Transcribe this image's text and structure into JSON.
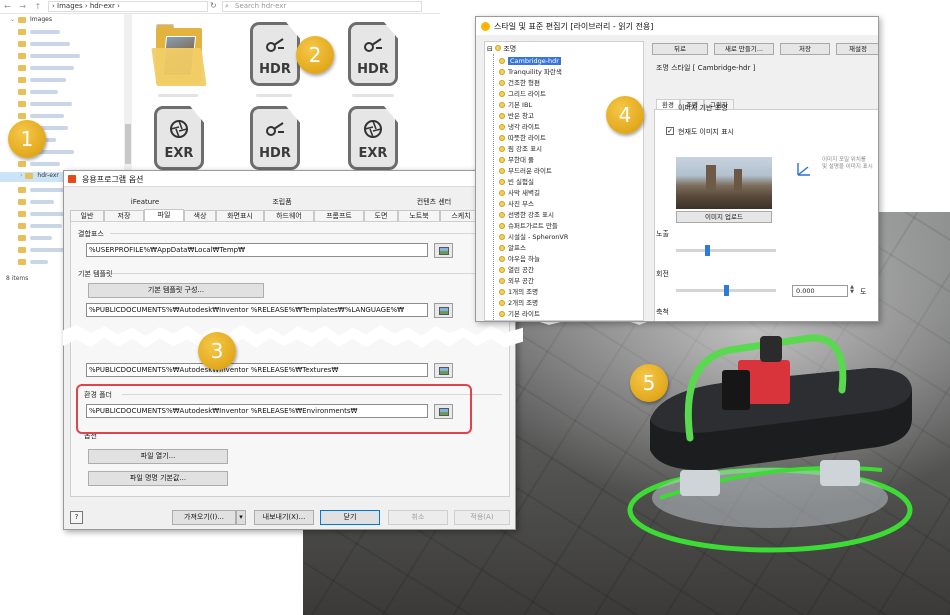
{
  "explorer": {
    "path": "› Images › hdr-exr ›",
    "search_placeholder": "Search hdr-exr",
    "tree_root": "Images",
    "tree_selected": "hdr-exr",
    "items_count": "8 items",
    "files": [
      {
        "type": "folder",
        "label": ""
      },
      {
        "type": "HDR",
        "label": "HDR"
      },
      {
        "type": "HDR",
        "label": "HDR"
      },
      {
        "type": "EXR",
        "label": "EXR"
      },
      {
        "type": "HDR",
        "label": "HDR"
      },
      {
        "type": "EXR",
        "label": "EXR"
      }
    ]
  },
  "markers": [
    "1",
    "2",
    "3",
    "4",
    "5"
  ],
  "options_dialog": {
    "title": "응용프로그램 옵션",
    "tabs_top": [
      "iFeature",
      "조립품",
      "컨텐츠 센터"
    ],
    "tabs_bottom": [
      "일반",
      "저장",
      "파일",
      "색상",
      "화면표시",
      "하드웨어",
      "프롬프트",
      "도면",
      "노트북",
      "스케치"
    ],
    "active_tab": "파일",
    "workspace_label": "결합표스",
    "workspace_value": "%USERPROFILE%₩AppData₩Local₩Temp₩",
    "templates_label": "기본 템플릿",
    "templates_button": "기본 템플릿 구성...",
    "templates_value": "%PUBLICDOCUMENTS%₩Autodesk₩Inventor %RELEASE%₩Templates₩%LANGUAGE%₩",
    "textures_value": "%PUBLICDOCUMENTS%₩Autodesk₩Inventor %RELEASE%₩Textures₩",
    "environments_label": "환경 폴더",
    "environments_value": "%PUBLICDOCUMENTS%₩Autodesk₩Inventor %RELEASE%₩Environments₩",
    "options_label": "옵션",
    "file_open_button": "파일 열기...",
    "file_name_button": "파일 명명 기본값...",
    "import_button": "가져오기(I)...",
    "export_button": "내보내기(X)...",
    "close_button": "닫기",
    "cancel_button": "취소",
    "apply_button": "적용(A)",
    "help_label": "?"
  },
  "style_editor": {
    "title": "스타일 및 표준 편집기 [라이브러리 - 읽기 전용]",
    "tree_root": "조명",
    "tree_items": [
      "Cambridge-hdr",
      "Tranquility 파란색",
      "건조한 형편",
      "그리드 라이트",
      "기본 IBL",
      "반은 창고",
      "냉각 라이트",
      "따뜻한 라이트",
      "림 강조 표시",
      "무한대 풀",
      "부드러운 라이트",
      "빈 실험실",
      "사막 새벽길",
      "사진 부스",
      "선명한 강조 표시",
      "슈퍼트가르트 만들",
      "시설실 - SpheronVR",
      "알프스",
      "야우음 하늘",
      "열린 공간",
      "외부 공간",
      "1개의 조명",
      "2개의 조명",
      "기본 라이트"
    ],
    "selected_item": "Cambridge-hdr",
    "buttons": [
      "뒤로",
      "새로 만들기...",
      "저장",
      "재설정"
    ],
    "style_label": "조명 스타일 [ Cambridge-hdr ]",
    "tabs": [
      "환경",
      "조명",
      "그림자"
    ],
    "active_tab": "환경",
    "ibl_label": "이미지 기반 조명",
    "show_scene_image": "현재도 이미지 표시",
    "image_button": "이미지 업로드",
    "brightness_label": "노출",
    "rotation_label": "회전",
    "rotation_value": "0.000",
    "rotation_unit": "도",
    "scale_label": "축척",
    "side_note": "이미지 포밀 위치를\n및 설명을 이미지 표시",
    "brightness_level": 0.3,
    "rotation_level": 0.5
  },
  "colors": {
    "highlight": "#e0444a",
    "marker": "#e2a81b",
    "accent": "#0078d7",
    "device_green": "#3cdc34",
    "device_red": "#d9343b"
  }
}
